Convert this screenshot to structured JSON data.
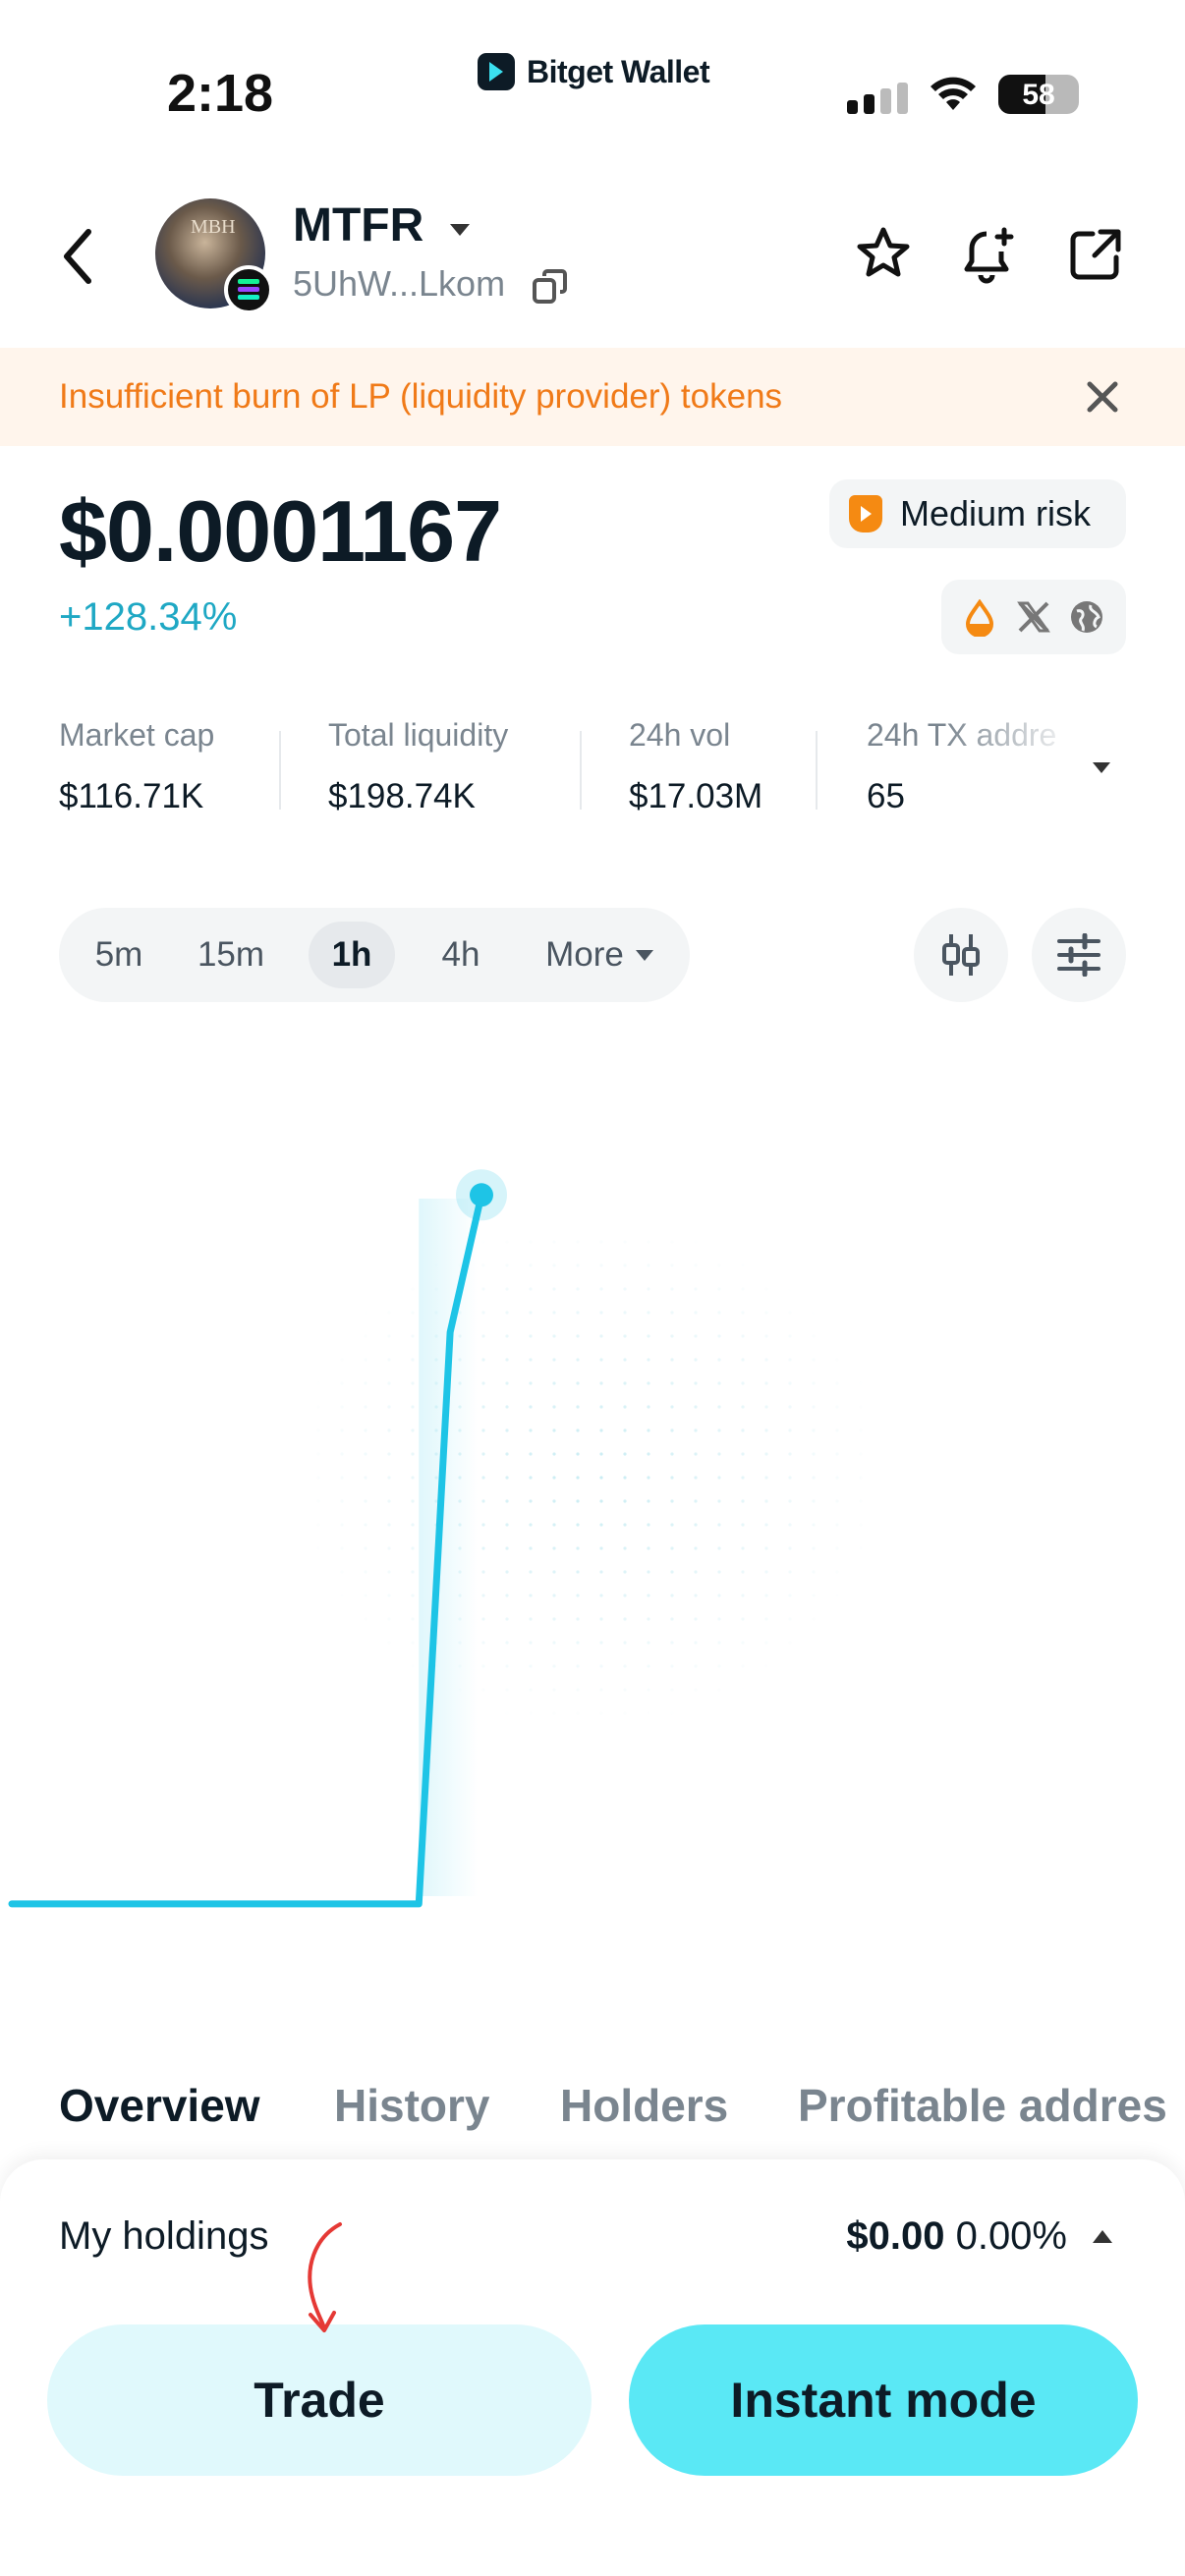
{
  "status_bar": {
    "time": "2:18",
    "app_brand": "Bitget Wallet",
    "battery": "58",
    "battery_level": 0.58
  },
  "header": {
    "token_name": "MTFR",
    "token_address": "5UhW...Lkom",
    "avatar_text": "MBH"
  },
  "alert": {
    "message": "Insufficient burn of LP (liquidity provider) tokens"
  },
  "price": {
    "value": "$0.0001167",
    "change": "+128.34%",
    "risk_label": "Medium risk"
  },
  "stats": [
    {
      "label": "Market cap",
      "value": "$116.71K"
    },
    {
      "label": "Total liquidity",
      "value": "$198.74K"
    },
    {
      "label": "24h vol",
      "value": "$17.03M"
    },
    {
      "label": "24h TX addre",
      "value": "65"
    }
  ],
  "intervals": {
    "items": [
      "5m",
      "15m",
      "1h",
      "4h",
      "More"
    ],
    "selected": "1h"
  },
  "chart_data": {
    "type": "line",
    "x": [
      0,
      1,
      2,
      3,
      4,
      5,
      6,
      7,
      8,
      9,
      10,
      11,
      12,
      13,
      14,
      15
    ],
    "values": [
      5.11e-05,
      5.11e-05,
      5.11e-05,
      5.11e-05,
      5.11e-05,
      5.11e-05,
      5.11e-05,
      5.11e-05,
      5.11e-05,
      5.11e-05,
      5.11e-05,
      5.11e-05,
      5.11e-05,
      5.11e-05,
      0.000104,
      0.0001167
    ],
    "ylim": [
      5e-05,
      0.00012
    ],
    "line_color": "#1ec4e6",
    "grid": false
  },
  "tabs": [
    "Overview",
    "History",
    "Holders",
    "Profitable addres"
  ],
  "holdings": {
    "label": "My holdings",
    "amount": "$0.00",
    "percent": "0.00%"
  },
  "buttons": {
    "trade": "Trade",
    "instant": "Instant mode"
  },
  "colors": {
    "accent": "#5ae8f5",
    "positive": "#1fa8c4",
    "warning": "#f07a18",
    "risk": "#f58a12"
  }
}
